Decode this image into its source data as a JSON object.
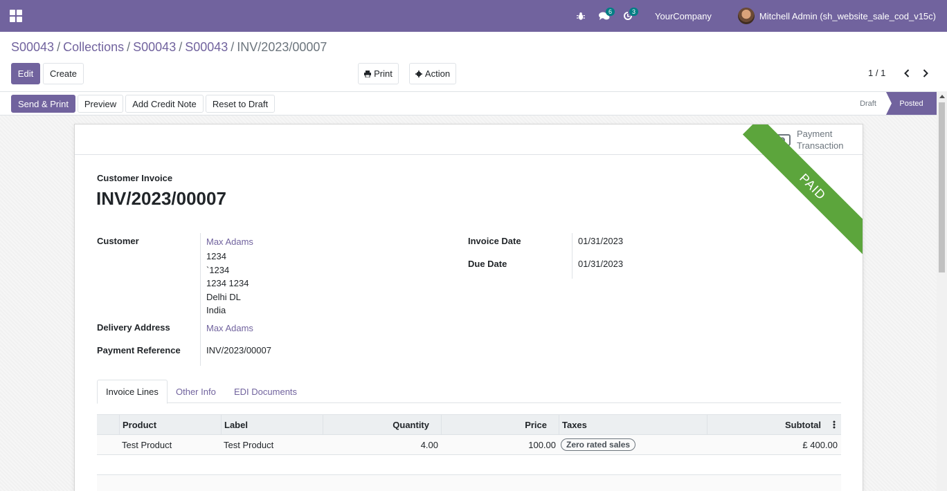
{
  "navbar": {
    "bug_icon": "bug-icon",
    "messages_badge": "6",
    "activities_badge": "3",
    "company": "YourCompany",
    "user": "Mitchell Admin (sh_website_sale_cod_v15c)"
  },
  "breadcrumb": {
    "items": [
      "S00043",
      "Collections",
      "S00043",
      "S00043"
    ],
    "current": "INV/2023/00007",
    "separator": "/"
  },
  "control": {
    "edit": "Edit",
    "create": "Create",
    "print": "Print",
    "action": "Action",
    "pager": "1 / 1"
  },
  "statusbar": {
    "buttons": [
      "Send & Print",
      "Preview",
      "Add Credit Note",
      "Reset to Draft"
    ],
    "stages": [
      "Draft",
      "Posted"
    ],
    "active_stage": "Posted"
  },
  "smart_button": {
    "line1": "Payment",
    "line2": "Transaction"
  },
  "ribbon": "PAID",
  "invoice": {
    "type": "Customer Invoice",
    "name": "INV/2023/00007",
    "customer_label": "Customer",
    "customer_name": "Max Adams",
    "address": [
      "1234",
      "`1234",
      "1234 1234",
      "Delhi DL",
      "India"
    ],
    "delivery_label": "Delivery Address",
    "delivery_value": "Max Adams",
    "payment_ref_label": "Payment Reference",
    "payment_ref_value": "INV/2023/00007",
    "invoice_date_label": "Invoice Date",
    "invoice_date_value": "01/31/2023",
    "due_date_label": "Due Date",
    "due_date_value": "01/31/2023"
  },
  "tabs": [
    "Invoice Lines",
    "Other Info",
    "EDI Documents"
  ],
  "lines": {
    "headers": [
      "Product",
      "Label",
      "Quantity",
      "Price",
      "Taxes",
      "Subtotal"
    ],
    "rows": [
      {
        "product": "Test Product",
        "label": "Test Product",
        "quantity": "4.00",
        "price": "100.00",
        "taxes": "Zero rated sales",
        "subtotal": "£ 400.00"
      }
    ]
  },
  "colors": {
    "brand": "#71639e",
    "ribbon": "#5ca53c",
    "badge": "#017e84"
  }
}
